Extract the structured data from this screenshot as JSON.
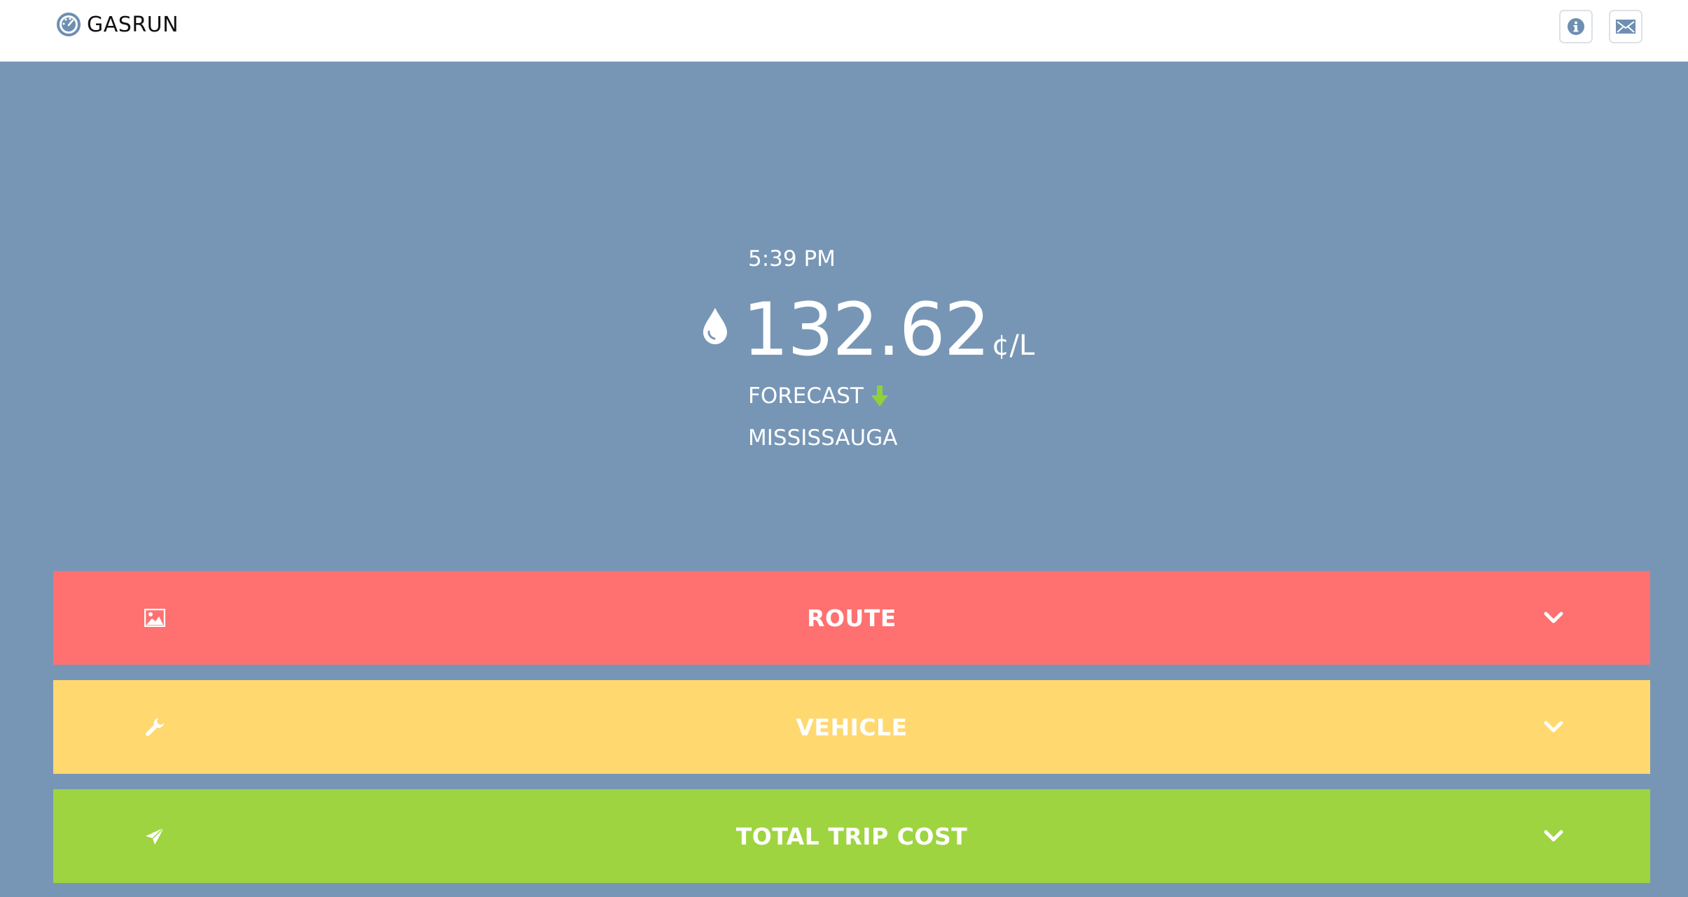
{
  "header": {
    "brand": "GASRUN",
    "brand_icon": "speedometer-icon",
    "buttons": [
      {
        "icon": "info-icon"
      },
      {
        "icon": "mail-icon"
      }
    ]
  },
  "hero": {
    "time": "5:39 PM",
    "price": "132.62",
    "unit": "¢/L",
    "forecast_label": "FORECAST",
    "forecast_direction": "down",
    "forecast_color": "#8fd13b",
    "city": "MISSISSAUGA"
  },
  "panels": [
    {
      "label": "ROUTE",
      "icon": "image-icon",
      "color": "#fe7170"
    },
    {
      "label": "VEHICLE",
      "icon": "wrench-icon",
      "color": "#ffd870"
    },
    {
      "label": "TOTAL TRIP COST",
      "icon": "paper-plane-icon",
      "color": "#9ed43f"
    }
  ],
  "colors": {
    "background": "#7796b5",
    "header": "#ffffff"
  }
}
